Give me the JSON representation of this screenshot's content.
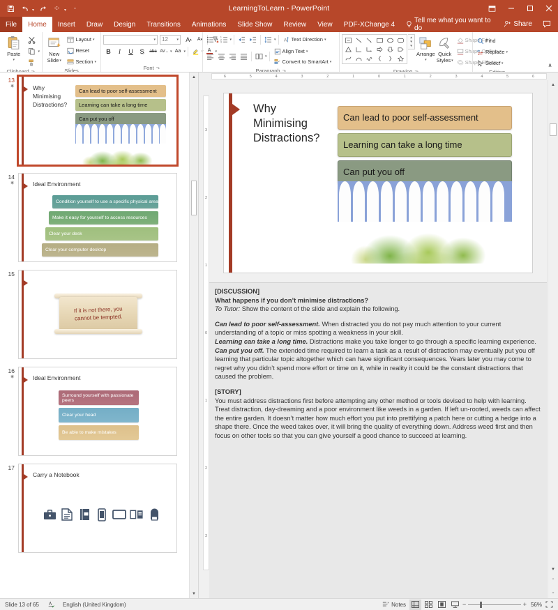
{
  "window": {
    "title": "LearningToLearn  -  PowerPoint",
    "qat": [
      {
        "name": "save",
        "glyph": "⬒"
      },
      {
        "name": "undo",
        "glyph": "↶"
      },
      {
        "name": "redo",
        "glyph": "↻"
      },
      {
        "name": "start-from-beginning",
        "glyph": "▶"
      },
      {
        "name": "customize-quick-access-toolbar",
        "glyph": "▾"
      }
    ],
    "controls": {
      "ribbon_display_options": "⬜",
      "minimize": "─",
      "maximize": "☐",
      "close": "✕"
    }
  },
  "tabs": [
    {
      "label": "File",
      "active": false,
      "file": true
    },
    {
      "label": "Home",
      "active": true
    },
    {
      "label": "Insert",
      "active": false
    },
    {
      "label": "Draw",
      "active": false
    },
    {
      "label": "Design",
      "active": false
    },
    {
      "label": "Transitions",
      "active": false
    },
    {
      "label": "Animations",
      "active": false
    },
    {
      "label": "Slide Show",
      "active": false
    },
    {
      "label": "Review",
      "active": false
    },
    {
      "label": "View",
      "active": false
    },
    {
      "label": "PDF-XChange 4",
      "active": false
    }
  ],
  "tellme": {
    "label": "Tell me what you want to do",
    "icon": "lightbulb-icon"
  },
  "share": {
    "label": "Share",
    "icon": "share-person-icon"
  },
  "comments": {
    "icon": "comments-icon"
  },
  "ribbon": {
    "clipboard": {
      "label": "Clipboard",
      "paste": "Paste",
      "cut": "Cut",
      "copy": "Copy",
      "format_painter": "Format Painter"
    },
    "slides": {
      "label": "Slides",
      "new_slide": "New\nSlide",
      "new_slide_l1": "New",
      "new_slide_l2": "Slide",
      "layout": "Layout",
      "reset": "Reset",
      "section": "Section"
    },
    "font": {
      "label": "Font",
      "font_name": "",
      "font_size": "12",
      "increase_font": "A",
      "decrease_font": "A",
      "clear_formatting": "✐",
      "bold": "B",
      "italic": "I",
      "underline": "U",
      "shadow": "S",
      "strikethrough": "abc",
      "character_spacing": "AV",
      "change_case": "Aa",
      "text_highlight": "✎",
      "font_color": "A"
    },
    "paragraph": {
      "label": "Paragraph",
      "bullets": "☰",
      "numbering": "☷",
      "decrease_indent": "⇤",
      "increase_indent": "⇥",
      "line_spacing": "≡",
      "align_left": "≡",
      "align_center": "≡",
      "align_right": "≡",
      "justify": "≡",
      "columns": "☷",
      "text_direction": "Text Direction",
      "align_text": "Align Text",
      "convert_to_smartart": "Convert to SmartArt"
    },
    "drawing": {
      "label": "Drawing",
      "shapes": [
        "⬒",
        "╲",
        "╲",
        "▭",
        "○",
        "▭",
        "△",
        "⌐",
        "↳",
        "⇨",
        "⇩",
        "⌐",
        "❀",
        "⌢",
        "∿",
        "(",
        ")",
        "☆"
      ],
      "arrange": "Arrange",
      "quick_styles_l1": "Quick",
      "quick_styles_l2": "Styles",
      "shape_fill": "Shape Fill",
      "shape_outline": "Shape Outline",
      "shape_effects": "Shape Effects"
    },
    "editing": {
      "label": "Editing",
      "find": "Find",
      "replace": "Replace",
      "select": "Select"
    },
    "collapse_ribbon": "∧"
  },
  "thumbnails": [
    {
      "number": "13",
      "starred": true,
      "selected": true,
      "title": "Why\nMinimising\nDistractions?",
      "title_lines": [
        "Why",
        "Minimising",
        "Distractions?"
      ],
      "bars": [
        {
          "text": "Can lead to poor self-assessment",
          "color": "#e3bf8a"
        },
        {
          "text": "Learning can take a long time",
          "color": "#b6c08a"
        },
        {
          "text": "Can put you off",
          "color": "#8a9a82"
        }
      ],
      "art": "fence-garden-image"
    },
    {
      "number": "14",
      "starred": true,
      "selected": false,
      "title": "Ideal Environment",
      "bars": [
        {
          "text": "Condition yourself to use a specific physical area",
          "color": "#5a9c96"
        },
        {
          "text": "Make it easy for yourself to access resources",
          "color": "#6fa873"
        },
        {
          "text": "Clear your desk",
          "color": "#9fbf7e"
        },
        {
          "text": "Clear your computer desktop",
          "color": "#b5ad84"
        }
      ]
    },
    {
      "number": "15",
      "starred": false,
      "selected": false,
      "title": "",
      "scroll_text": "If it is not there, you cannot be tempted."
    },
    {
      "number": "16",
      "starred": true,
      "selected": false,
      "title": "Ideal Environment",
      "bars": [
        {
          "text": "Surround yourself with passionate peers",
          "color": "#ac6a77"
        },
        {
          "text": "Clear your head",
          "color": "#74aec6"
        },
        {
          "text": "Be able to make mistakes",
          "color": "#ddc08b"
        }
      ]
    },
    {
      "number": "17",
      "starred": false,
      "selected": false,
      "title": "Carry a Notebook",
      "icons": [
        "briefcase-icon",
        "document-icon",
        "binder-icon",
        "smartphone-icon",
        "monitor-icon",
        "open-book-icon",
        "backpack-icon"
      ]
    }
  ],
  "ruler": {
    "horizontal": [
      "6",
      "5",
      "4",
      "3",
      "2",
      "1",
      "0",
      "1",
      "2",
      "3",
      "4",
      "5",
      "6"
    ],
    "vertical": [
      "3",
      "2",
      "1",
      "0",
      "1",
      "2",
      "3"
    ]
  },
  "slide": {
    "title_lines": [
      "Why",
      "Minimising",
      "Distractions?"
    ],
    "bars": [
      {
        "text": "Can lead to poor self-assessment",
        "color": "#e3bf8a",
        "border": "#c8a372"
      },
      {
        "text": "Learning can take a long time",
        "color": "#b6c08a",
        "border": "#9ba572"
      },
      {
        "text": "Can put you off",
        "color": "#8a9a82",
        "border": "#748270"
      }
    ]
  },
  "notes": {
    "discussion_heading": "[DISCUSSION]",
    "discussion_question": "What happens if you don’t minimise distractions?",
    "to_tutor_label": "To Tutor:",
    "to_tutor_text": " Show the content of the slide and explain the following.",
    "points": [
      {
        "lead": "Can lead to poor self-assessment.",
        "text": " When distracted you do not pay much attention to your current understanding of a topic or miss spotting a weakness in your skill."
      },
      {
        "lead": "Learning can take a long time.",
        "text": " Distractions make you take longer to go through a specific learning experience."
      },
      {
        "lead": "Can put you off.",
        "text": " The extended time required to learn a task as a result of distraction may eventually put you off learning that particular topic altogether which can have significant consequences. Years later you may come to regret why you didn’t spend more effort or time on it, while in reality it could be the constant distractions that caused the problem."
      }
    ],
    "story_heading": "[STORY]",
    "story_text": "You must address distractions first before attempting any other method or tools devised to help with learning. Treat distraction, day-dreaming and a poor environment like weeds in a garden. If left un-rooted, weeds can affect the entire garden. It doesn’t matter how much effort you put into prettifying a patch here or cutting a hedge into a shape there. Once the weed takes over, it will bring the quality of everything down. Address weed first and then focus on other tools so that you can give yourself a good chance to succeed at learning."
  },
  "statusbar": {
    "slide_counter": "Slide 13 of 65",
    "spellcheck_icon": "spellcheck-icon",
    "language": "English (United Kingdom)",
    "notes_label": "Notes",
    "views": [
      {
        "name": "normal-view",
        "glyph": "▤",
        "active": true
      },
      {
        "name": "slide-sorter-view",
        "glyph": "☷",
        "active": false
      },
      {
        "name": "reading-view",
        "glyph": "◫",
        "active": false
      },
      {
        "name": "slide-show-view",
        "glyph": "▱",
        "active": false
      }
    ],
    "zoom_out": "−",
    "zoom_in": "+",
    "zoom_value": "56%",
    "fit_to_window": "⛶"
  },
  "colors": {
    "accent": "#b7472a",
    "slide_accent": "#a33b26",
    "selection": "#c0482b"
  }
}
